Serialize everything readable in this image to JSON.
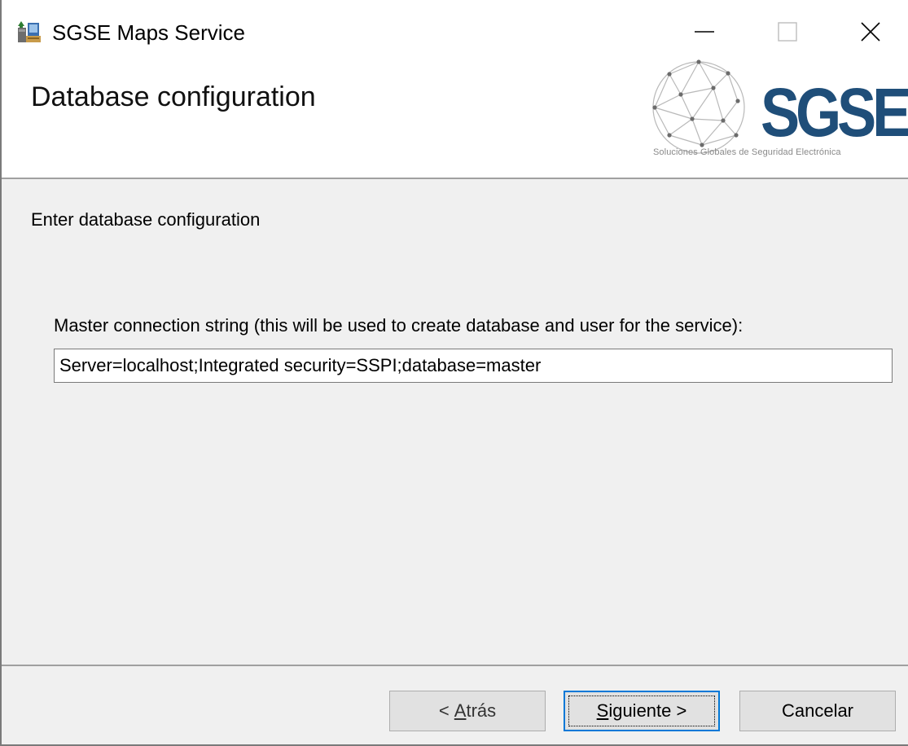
{
  "window": {
    "title": "SGSE Maps Service",
    "controls": {
      "minimize": "minimize-icon",
      "maximize": "maximize-icon",
      "close": "close-icon"
    }
  },
  "banner": {
    "title": "Database configuration",
    "logo": {
      "text": "SGSE",
      "tagline": "Soluciones Globales de Seguridad Electrónica",
      "brand_color": "#1f4e79"
    }
  },
  "content": {
    "instruction": "Enter database configuration",
    "connection_label": "Master connection string (this will be used to create database and user for the service):",
    "connection_value": "Server=localhost;Integrated security=SSPI;database=master"
  },
  "footer": {
    "back_prefix": "< ",
    "back_mnemonic": "A",
    "back_rest": "trás",
    "next_mnemonic": "S",
    "next_rest": "iguiente >",
    "cancel_label": "Cancelar",
    "focus_color": "#0078d7"
  }
}
